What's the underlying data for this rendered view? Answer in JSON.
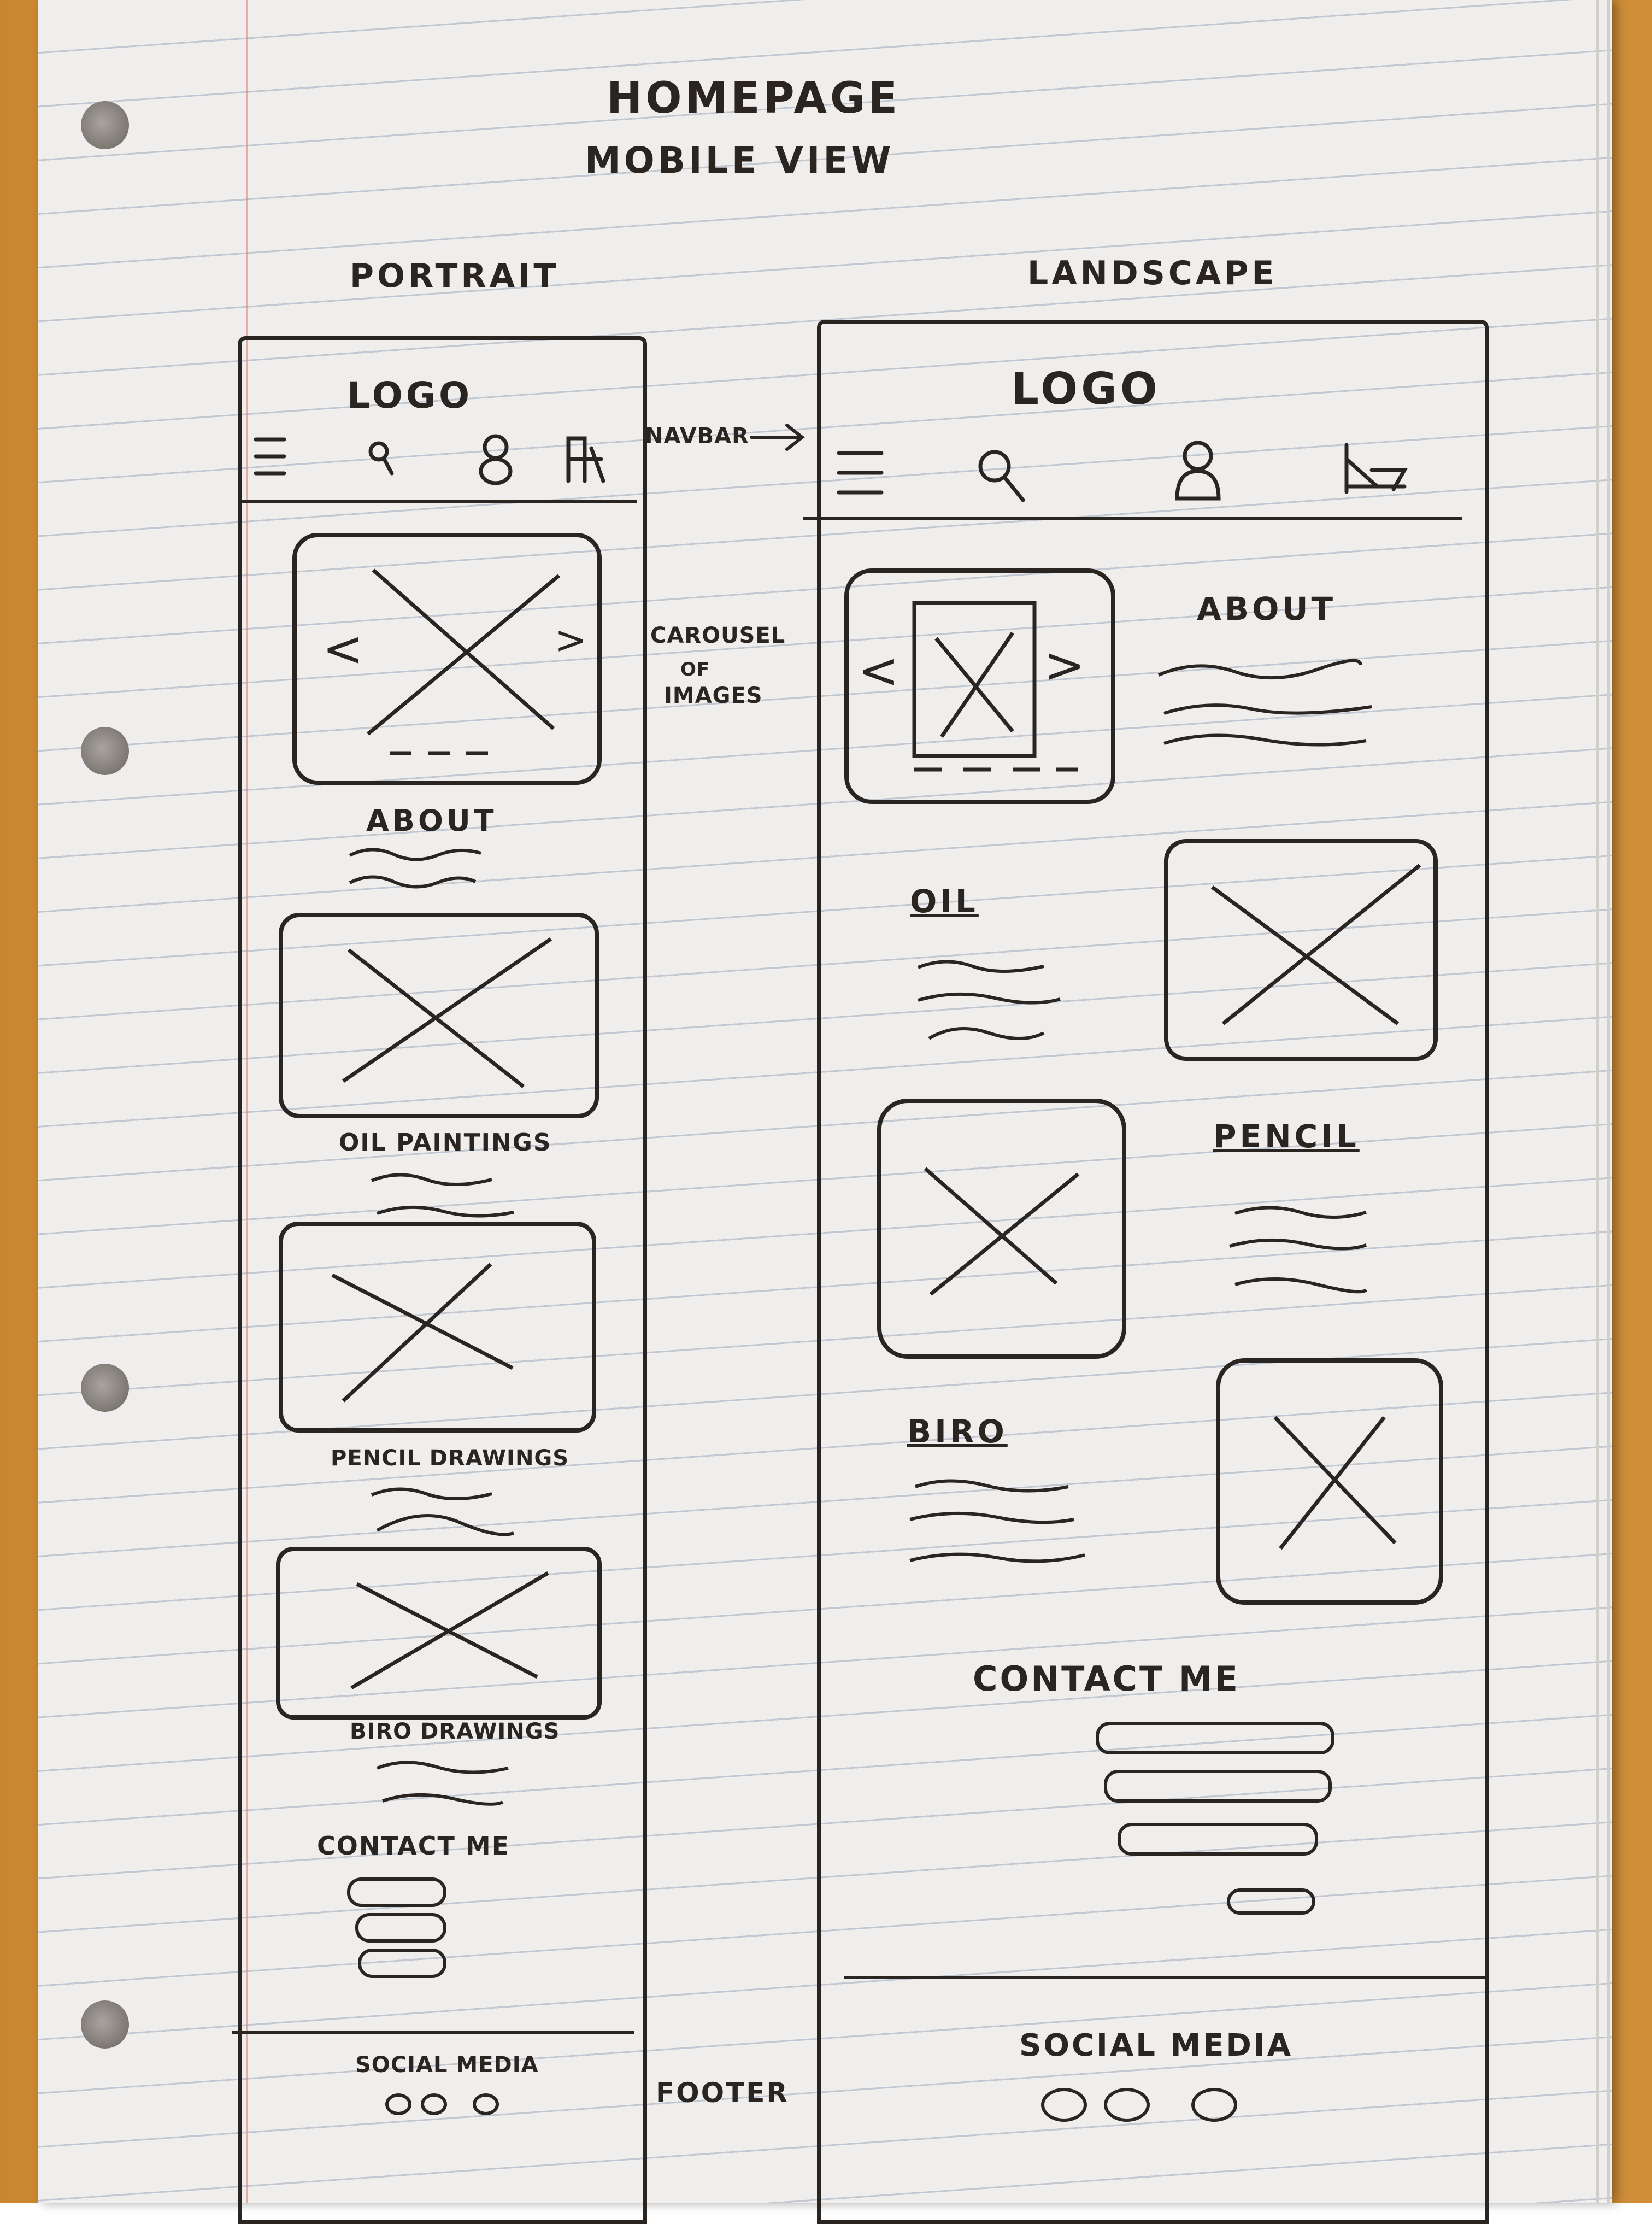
{
  "title": "HOMEPAGE",
  "subtitle": "MOBILE VIEW",
  "portrait": {
    "heading": "PORTRAIT",
    "logo": "LOGO",
    "navbar_icons": [
      "menu-icon",
      "search-icon",
      "user-icon",
      "cart-icon"
    ],
    "sections": [
      "ABOUT",
      "OIL PAINTINGS",
      "PENCIL DRAWINGS",
      "BIRO DRAWINGS"
    ],
    "contact_heading": "CONTACT ME",
    "footer_label": "SOCIAL MEDIA"
  },
  "landscape": {
    "heading": "LANDSCAPE",
    "logo": "LOGO",
    "navbar_icons": [
      "menu-icon",
      "search-icon",
      "user-icon",
      "cart-icon"
    ],
    "about_heading": "ABOUT",
    "sections": [
      "OIL",
      "PENCIL",
      "BIRO"
    ],
    "contact_heading": "CONTACT ME",
    "footer_label": "SOCIAL MEDIA"
  },
  "annotations": {
    "navbar": "NAVBAR",
    "carousel_line1": "CAROUSEL",
    "carousel_line2": "OF",
    "carousel_line3": "IMAGES",
    "footer": "FOOTER"
  }
}
